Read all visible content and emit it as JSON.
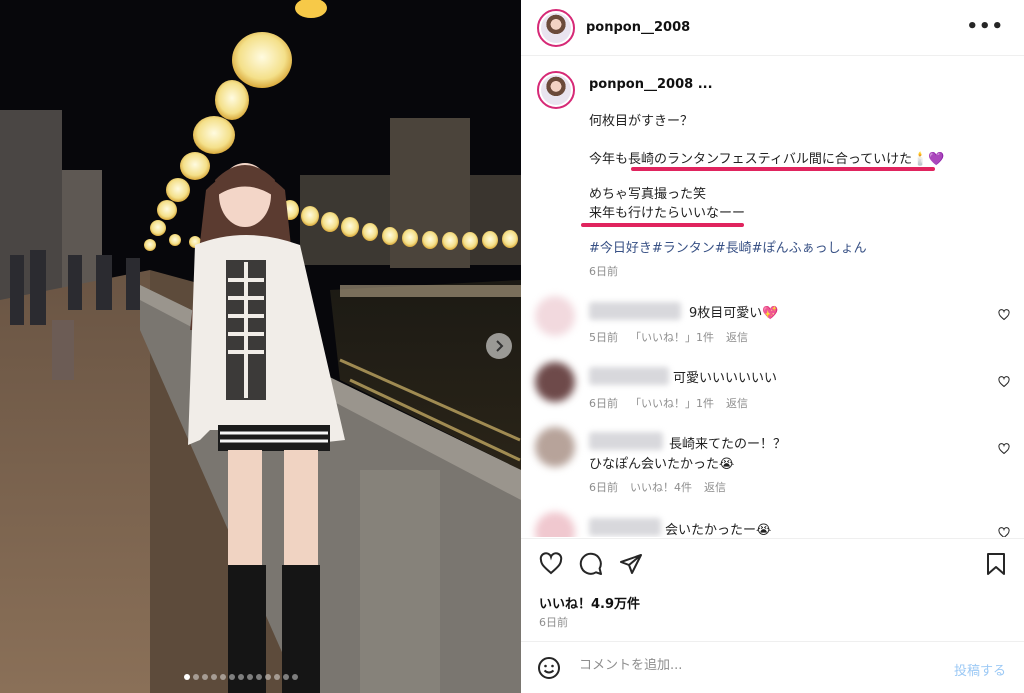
{
  "header": {
    "username": "ponpon__2008",
    "more_label": "•••"
  },
  "caption": {
    "username": "ponpon__2008 ...",
    "lines": [
      "何枚目がすきー？",
      "今年も長崎のランタンフェスティバル間に合っていけた🕯️💜",
      "めちゃ写真撮った笑",
      "来年も行けたらいいなーー"
    ],
    "hashtags": "#今日好き#ランタン#長崎#ぽんふぁっしょん",
    "time": "6日前"
  },
  "comments": [
    {
      "text": "9枚目可愛い💖",
      "time": "5日前",
      "likes": "「いいね！」1件",
      "reply": "返信",
      "avatar_color": "#f2d9de"
    },
    {
      "text": "可愛いいいいいい",
      "time": "6日前",
      "likes": "「いいね！」1件",
      "reply": "返信",
      "avatar_color": "#6e4a4a"
    },
    {
      "text": "長崎来てたのー！？",
      "text2": "ひなぽん会いたかった😭",
      "time": "6日前",
      "likes": "いいね！4件",
      "reply": "返信",
      "avatar_color": "#b7a39a"
    },
    {
      "text": "会いたかったー😭",
      "avatar_color": "#f0c8cf"
    }
  ],
  "likes_text": "いいね！4.9万件",
  "date_text": "6日前",
  "comment_box": {
    "placeholder": "コメントを追加...",
    "post_label": "投稿する"
  },
  "carousel": {
    "total": 13,
    "active_index": 0
  },
  "colors": {
    "accent_underline": "#e0245e",
    "hashtag": "#385185",
    "post_button": "#9cc9f5",
    "story_ring": "#d62976"
  }
}
